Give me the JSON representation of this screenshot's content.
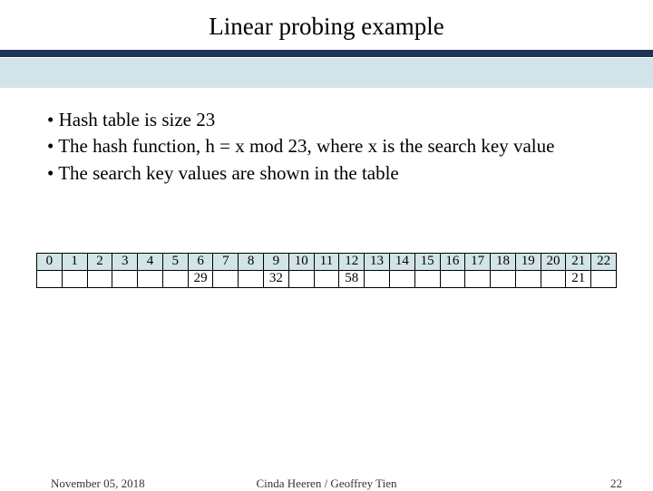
{
  "title": "Linear probing example",
  "bullets": [
    "Hash table is size 23",
    "The hash function, h = x mod 23, where x is the search key value",
    "The search key values are shown in the table"
  ],
  "table": {
    "indices": [
      "0",
      "1",
      "2",
      "3",
      "4",
      "5",
      "6",
      "7",
      "8",
      "9",
      "10",
      "11",
      "12",
      "13",
      "14",
      "15",
      "16",
      "17",
      "18",
      "19",
      "20",
      "21",
      "22"
    ],
    "values": [
      "",
      "",
      "",
      "",
      "",
      "",
      "29",
      "",
      "",
      "32",
      "",
      "",
      "58",
      "",
      "",
      "",
      "",
      "",
      "",
      "",
      "",
      "21",
      ""
    ]
  },
  "footer": {
    "date": "November 05, 2018",
    "authors": "Cinda Heeren / Geoffrey Tien",
    "page": "22"
  }
}
